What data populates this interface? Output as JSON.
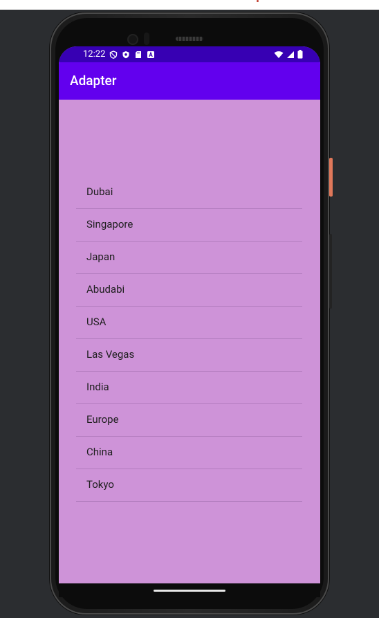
{
  "status_bar": {
    "time": "12:22",
    "left_icons": [
      "shield-outline-icon",
      "shield-filled-icon",
      "sd-card-icon",
      "text-a-icon"
    ],
    "right_icons": [
      "wifi-icon",
      "cell-signal-icon",
      "battery-icon"
    ]
  },
  "app_bar": {
    "title": "Adapter"
  },
  "list": {
    "items": [
      {
        "label": "Dubai"
      },
      {
        "label": "Singapore"
      },
      {
        "label": "Japan"
      },
      {
        "label": "Abudabi"
      },
      {
        "label": "USA"
      },
      {
        "label": "Las Vegas"
      },
      {
        "label": "India"
      },
      {
        "label": "Europe"
      },
      {
        "label": "China"
      },
      {
        "label": "Tokyo"
      }
    ]
  },
  "colors": {
    "status_bar": "#3700b3",
    "app_bar": "#6200ee",
    "screen_background": "#ce93d8",
    "divider": "#b27cbe",
    "frame_background": "#2b2d30"
  }
}
